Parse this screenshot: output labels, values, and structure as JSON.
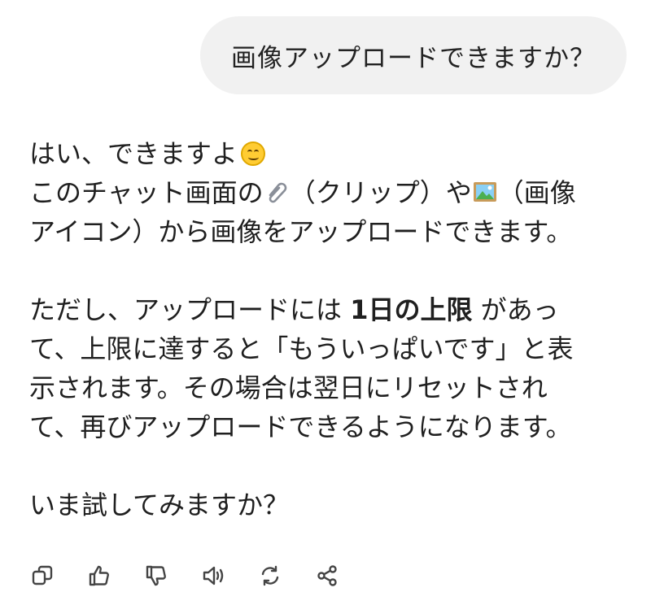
{
  "user_message": {
    "text": "画像アップロードできますか？"
  },
  "assistant_message": {
    "para1": {
      "line1": "はい、できますよ",
      "line2_a": "このチャット画面の",
      "line2_b": "（クリップ）や",
      "line2_c": "（画像",
      "line3": "アイコン）から画像をアップロードできます。"
    },
    "para2": {
      "line1_a": "ただし、アップロードには ",
      "line1_bold": "1日の上限",
      "line1_b": " があっ",
      "line2": "て、上限に達すると「もういっぱいです」と表",
      "line3": "示されます。その場合は翌日にリセットされ",
      "line4": "て、再びアップロードできるようになります。"
    },
    "para3": {
      "line1": "いま試してみますか？"
    }
  },
  "icons": {
    "smile": "smiling-face-emoji",
    "clip": "paperclip-emoji",
    "picture": "framed-picture-emoji"
  },
  "actions": [
    "copy",
    "thumbs-up",
    "thumbs-down",
    "read-aloud",
    "regenerate",
    "share"
  ]
}
